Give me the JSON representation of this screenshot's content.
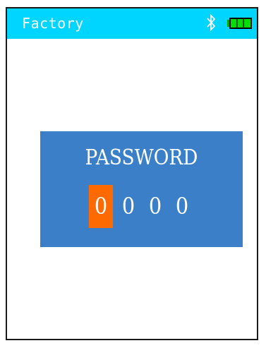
{
  "status_bar": {
    "title": "Factory",
    "bluetooth_icon": "bluetooth-icon",
    "battery_icon": "battery-full-icon",
    "bg_color": "#00d5ff",
    "battery_color": "#00cc00"
  },
  "password_dialog": {
    "title": "PASSWORD",
    "digits": [
      "0",
      "0",
      "0",
      "0"
    ],
    "active_index": 0,
    "bg_color": "#3b7fc8",
    "active_color": "#ff6a00"
  }
}
